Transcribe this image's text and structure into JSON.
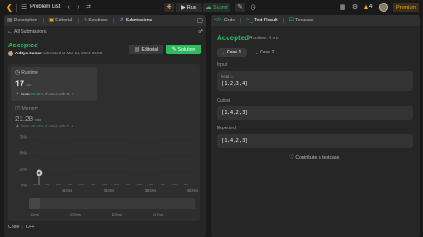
{
  "topbar": {
    "problem_list": "Problem List",
    "run": "Run",
    "submit": "Submit",
    "streak": "4",
    "premium": "Premium"
  },
  "left": {
    "tabs": [
      "Description",
      "Editorial",
      "Solutions",
      "Submissions"
    ],
    "all_submissions": "All Submissions",
    "status": "Accepted",
    "user": "Aditya Kumar",
    "submitted_at": "submitted at Mar 24, 2024 08:58",
    "editorial_btn": "Editorial",
    "solution_btn": "Solution",
    "runtime": {
      "label": "Runtime",
      "value": "17",
      "unit": "ms",
      "beats_label": "Beats",
      "beats_pct": "96.86%",
      "beats_suffix": "of users with C++"
    },
    "memory": {
      "label": "Memory",
      "value": "21.28",
      "unit": "MB",
      "beats_label": "Beats",
      "beats_pct": "49.63%",
      "beats_suffix": "of users with C++"
    },
    "chart_data": {
      "type": "bar",
      "y_ticks": [
        "75%",
        "50%",
        "25%",
        "0%"
      ],
      "x_ticks": [
        "184ms",
        "283ms",
        "383ms",
        "483ms"
      ],
      "mini_ticks": [
        "11ms",
        "209ms",
        "409ms",
        "617ms"
      ],
      "ylim": [
        0,
        75
      ]
    },
    "code_label": "Code",
    "lang": "C++"
  },
  "right": {
    "tabs": [
      "Code",
      "Test Result",
      "Testcase"
    ],
    "status": "Accepted",
    "runtime": "Runtime: 0 ms",
    "cases": [
      "Case 1",
      "Case 2"
    ],
    "input_label": "Input",
    "input_var": "head =",
    "input_value": "[1,2,3,4]",
    "output_label": "Output",
    "output_value": "[1,4,2,3]",
    "expected_label": "Expected",
    "expected_value": "[1,4,2,3]",
    "contribute": "Contribute a testcase"
  },
  "colors": {
    "accent_green": "#2cbb5d",
    "accent_orange": "#ffa116"
  }
}
